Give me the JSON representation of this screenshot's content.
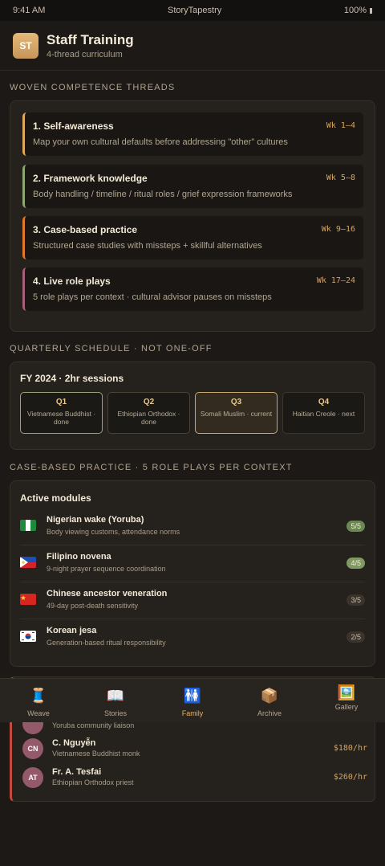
{
  "status": {
    "time": "9:41 AM",
    "app": "StoryTapestry",
    "battery": "100%"
  },
  "header": {
    "avatar": "ST",
    "title": "Staff Training",
    "subtitle": "4-thread curriculum"
  },
  "threads": {
    "label": "WOVEN COMPETENCE THREADS",
    "items": [
      {
        "title": "1. Self-awareness",
        "weeks": "Wk 1–4",
        "desc": "Map your own cultural defaults before addressing \"other\" cultures",
        "color": "#e0a85a"
      },
      {
        "title": "2. Framework knowledge",
        "weeks": "Wk 5–8",
        "desc": "Body handling / timeline / ritual roles / grief expression frameworks",
        "color": "#8fa572"
      },
      {
        "title": "3. Case-based practice",
        "weeks": "Wk 9–16",
        "desc": "Structured case studies with missteps + skillful alternatives",
        "color": "#e07a2e"
      },
      {
        "title": "4. Live role plays",
        "weeks": "Wk 17–24",
        "desc": "5 role plays per context · cultural advisor pauses on missteps",
        "color": "#a7607a"
      }
    ]
  },
  "schedule": {
    "label": "QUARTERLY SCHEDULE · NOT ONE-OFF",
    "title": "FY 2024 · 2hr sessions",
    "quarters": [
      {
        "name": "Q1",
        "desc": "Vietnamese Buddhist · done",
        "state": "done"
      },
      {
        "name": "Q2",
        "desc": "Ethiopian Orthodox · done",
        "state": "pending"
      },
      {
        "name": "Q3",
        "desc": "Somali Muslim · current",
        "state": "current"
      },
      {
        "name": "Q4",
        "desc": "Haitian Creole · next",
        "state": "next"
      }
    ]
  },
  "modules": {
    "label": "CASE-BASED PRACTICE · 5 ROLE PLAYS PER CONTEXT",
    "title": "Active modules",
    "items": [
      {
        "flag": "nigeria-flag-icon",
        "title": "Nigerian wake (Yoruba)",
        "sub": "Body viewing customs, attendance norms",
        "progress": "5/5",
        "state": "done"
      },
      {
        "flag": "philippines-flag-icon",
        "title": "Filipino novena",
        "sub": "9-night prayer sequence coordination",
        "progress": "4/5",
        "state": "partial"
      },
      {
        "flag": "china-flag-icon",
        "title": "Chinese ancestor veneration",
        "sub": "49-day post-death sensitivity",
        "progress": "3/5",
        "state": "low"
      },
      {
        "flag": "korea-flag-icon",
        "title": "Korean jesa",
        "sub": "Generation-based ritual responsibility",
        "progress": "2/5",
        "state": "low"
      }
    ]
  },
  "advisors": {
    "items": [
      {
        "initials": "",
        "name": "",
        "role": "Yoruba community liaison",
        "rate": ""
      },
      {
        "initials": "CN",
        "name": "C. Nguyễn",
        "role": "Vietnamese Buddhist monk",
        "rate": "$180/hr"
      },
      {
        "initials": "AT",
        "name": "Fr. A. Tesfai",
        "role": "Ethiopian Orthodox priest",
        "rate": "$260/hr"
      }
    ]
  },
  "tabs": [
    {
      "label": "Weave",
      "icon": "🧵",
      "icon_name": "thread-spool-icon"
    },
    {
      "label": "Stories",
      "icon": "📖",
      "icon_name": "book-icon"
    },
    {
      "label": "Family",
      "icon": "🚻",
      "icon_name": "family-icon",
      "active": true
    },
    {
      "label": "Archive",
      "icon": "📦",
      "icon_name": "box-icon"
    },
    {
      "label": "Gallery",
      "icon": "🖼️",
      "icon_name": "picture-icon"
    }
  ]
}
